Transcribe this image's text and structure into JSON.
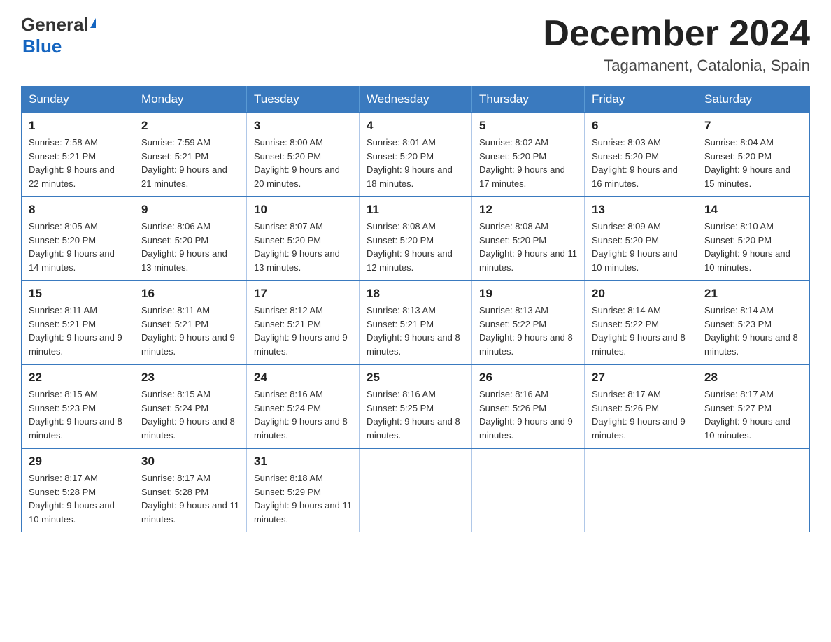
{
  "logo": {
    "general": "General",
    "blue": "Blue"
  },
  "header": {
    "month": "December 2024",
    "location": "Tagamanent, Catalonia, Spain"
  },
  "days_of_week": [
    "Sunday",
    "Monday",
    "Tuesday",
    "Wednesday",
    "Thursday",
    "Friday",
    "Saturday"
  ],
  "weeks": [
    [
      {
        "day": "1",
        "sunrise": "7:58 AM",
        "sunset": "5:21 PM",
        "daylight": "9 hours and 22 minutes."
      },
      {
        "day": "2",
        "sunrise": "7:59 AM",
        "sunset": "5:21 PM",
        "daylight": "9 hours and 21 minutes."
      },
      {
        "day": "3",
        "sunrise": "8:00 AM",
        "sunset": "5:20 PM",
        "daylight": "9 hours and 20 minutes."
      },
      {
        "day": "4",
        "sunrise": "8:01 AM",
        "sunset": "5:20 PM",
        "daylight": "9 hours and 18 minutes."
      },
      {
        "day": "5",
        "sunrise": "8:02 AM",
        "sunset": "5:20 PM",
        "daylight": "9 hours and 17 minutes."
      },
      {
        "day": "6",
        "sunrise": "8:03 AM",
        "sunset": "5:20 PM",
        "daylight": "9 hours and 16 minutes."
      },
      {
        "day": "7",
        "sunrise": "8:04 AM",
        "sunset": "5:20 PM",
        "daylight": "9 hours and 15 minutes."
      }
    ],
    [
      {
        "day": "8",
        "sunrise": "8:05 AM",
        "sunset": "5:20 PM",
        "daylight": "9 hours and 14 minutes."
      },
      {
        "day": "9",
        "sunrise": "8:06 AM",
        "sunset": "5:20 PM",
        "daylight": "9 hours and 13 minutes."
      },
      {
        "day": "10",
        "sunrise": "8:07 AM",
        "sunset": "5:20 PM",
        "daylight": "9 hours and 13 minutes."
      },
      {
        "day": "11",
        "sunrise": "8:08 AM",
        "sunset": "5:20 PM",
        "daylight": "9 hours and 12 minutes."
      },
      {
        "day": "12",
        "sunrise": "8:08 AM",
        "sunset": "5:20 PM",
        "daylight": "9 hours and 11 minutes."
      },
      {
        "day": "13",
        "sunrise": "8:09 AM",
        "sunset": "5:20 PM",
        "daylight": "9 hours and 10 minutes."
      },
      {
        "day": "14",
        "sunrise": "8:10 AM",
        "sunset": "5:20 PM",
        "daylight": "9 hours and 10 minutes."
      }
    ],
    [
      {
        "day": "15",
        "sunrise": "8:11 AM",
        "sunset": "5:21 PM",
        "daylight": "9 hours and 9 minutes."
      },
      {
        "day": "16",
        "sunrise": "8:11 AM",
        "sunset": "5:21 PM",
        "daylight": "9 hours and 9 minutes."
      },
      {
        "day": "17",
        "sunrise": "8:12 AM",
        "sunset": "5:21 PM",
        "daylight": "9 hours and 9 minutes."
      },
      {
        "day": "18",
        "sunrise": "8:13 AM",
        "sunset": "5:21 PM",
        "daylight": "9 hours and 8 minutes."
      },
      {
        "day": "19",
        "sunrise": "8:13 AM",
        "sunset": "5:22 PM",
        "daylight": "9 hours and 8 minutes."
      },
      {
        "day": "20",
        "sunrise": "8:14 AM",
        "sunset": "5:22 PM",
        "daylight": "9 hours and 8 minutes."
      },
      {
        "day": "21",
        "sunrise": "8:14 AM",
        "sunset": "5:23 PM",
        "daylight": "9 hours and 8 minutes."
      }
    ],
    [
      {
        "day": "22",
        "sunrise": "8:15 AM",
        "sunset": "5:23 PM",
        "daylight": "9 hours and 8 minutes."
      },
      {
        "day": "23",
        "sunrise": "8:15 AM",
        "sunset": "5:24 PM",
        "daylight": "9 hours and 8 minutes."
      },
      {
        "day": "24",
        "sunrise": "8:16 AM",
        "sunset": "5:24 PM",
        "daylight": "9 hours and 8 minutes."
      },
      {
        "day": "25",
        "sunrise": "8:16 AM",
        "sunset": "5:25 PM",
        "daylight": "9 hours and 8 minutes."
      },
      {
        "day": "26",
        "sunrise": "8:16 AM",
        "sunset": "5:26 PM",
        "daylight": "9 hours and 9 minutes."
      },
      {
        "day": "27",
        "sunrise": "8:17 AM",
        "sunset": "5:26 PM",
        "daylight": "9 hours and 9 minutes."
      },
      {
        "day": "28",
        "sunrise": "8:17 AM",
        "sunset": "5:27 PM",
        "daylight": "9 hours and 10 minutes."
      }
    ],
    [
      {
        "day": "29",
        "sunrise": "8:17 AM",
        "sunset": "5:28 PM",
        "daylight": "9 hours and 10 minutes."
      },
      {
        "day": "30",
        "sunrise": "8:17 AM",
        "sunset": "5:28 PM",
        "daylight": "9 hours and 11 minutes."
      },
      {
        "day": "31",
        "sunrise": "8:18 AM",
        "sunset": "5:29 PM",
        "daylight": "9 hours and 11 minutes."
      },
      null,
      null,
      null,
      null
    ]
  ]
}
